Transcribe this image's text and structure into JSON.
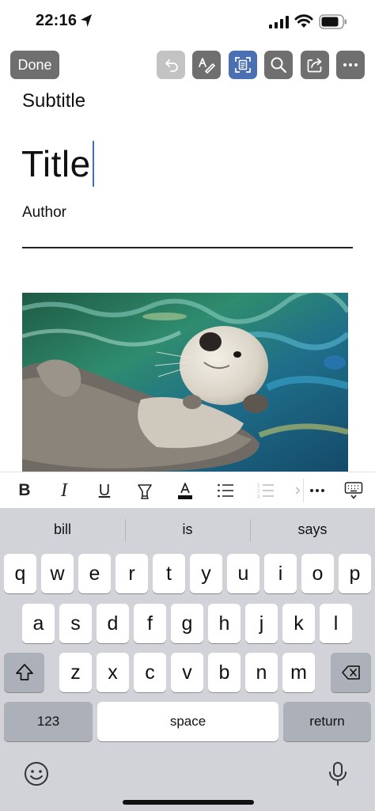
{
  "status_bar": {
    "time": "22:16"
  },
  "toolbar": {
    "done_label": "Done",
    "buttons": [
      {
        "name": "undo-icon",
        "state": "disabled"
      },
      {
        "name": "draw-icon",
        "state": "normal"
      },
      {
        "name": "focus-view-icon",
        "state": "active"
      },
      {
        "name": "search-icon",
        "state": "normal"
      },
      {
        "name": "share-icon",
        "state": "normal"
      },
      {
        "name": "more-icon",
        "state": "normal"
      }
    ]
  },
  "document": {
    "subtitle": "Subtitle",
    "title": "Title",
    "author": "Author",
    "image": {
      "subject": "sea otter floating on water"
    }
  },
  "format_bar": {
    "buttons": [
      "bold-icon",
      "italic-icon",
      "underline-icon",
      "highlight-icon",
      "font-color-icon",
      "bullet-list-icon",
      "numbered-list-icon",
      "more-icon",
      "keyboard-dismiss-icon"
    ],
    "bold_label": "B",
    "italic_label": "I",
    "underline_label": "U"
  },
  "keyboard": {
    "suggestions": [
      "bill",
      "is",
      "says"
    ],
    "row1": [
      "q",
      "w",
      "e",
      "r",
      "t",
      "y",
      "u",
      "i",
      "o",
      "p"
    ],
    "row2": [
      "a",
      "s",
      "d",
      "f",
      "g",
      "h",
      "j",
      "k",
      "l"
    ],
    "row3": [
      "z",
      "x",
      "c",
      "v",
      "b",
      "n",
      "m"
    ],
    "numbers_label": "123",
    "space_label": "space",
    "return_label": "return"
  },
  "colors": {
    "toolbar_button": "#6f6f6f",
    "toolbar_active": "#4a6fb3",
    "cursor": "#3b6fd6",
    "keyboard_bg": "#d1d3d9"
  }
}
